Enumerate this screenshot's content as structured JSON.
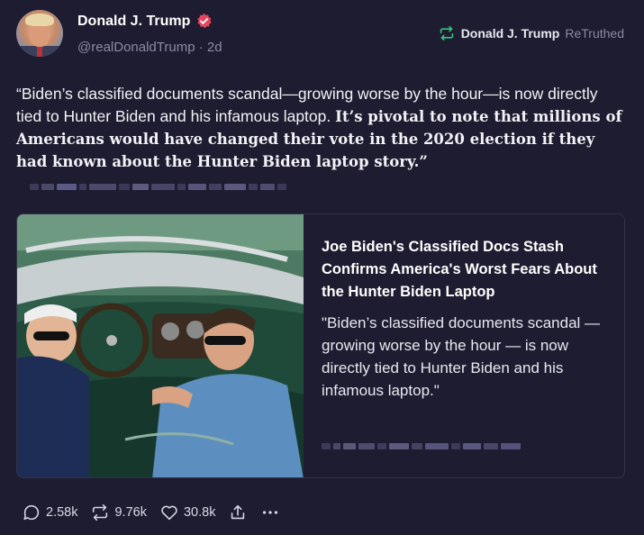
{
  "author": {
    "name": "Donald J. Trump",
    "handle": "@realDonaldTrump",
    "separator": "·",
    "age": "2d"
  },
  "retruth": {
    "name": "Donald J. Trump",
    "label": "ReTruthed"
  },
  "post": {
    "text_plain": "“Biden’s classified documents scandal—growing worse by the hour—is now directly tied to Hunter Biden and his infamous laptop.",
    "text_bold": "It’s pivotal to note that millions of Americans would have changed their vote in the 2020 election if they had known about the Hunter Biden laptop story.”"
  },
  "card": {
    "title": "Joe Biden's Classified Docs Stash Confirms America's Worst Fears About the Hunter Biden Laptop",
    "description": "\"Biden’s classified documents scandal — growing worse by the hour — is now directly tied to Hunter Biden and his infamous laptop.\""
  },
  "actions": {
    "replies": "2.58k",
    "retruths": "9.76k",
    "likes": "30.8k"
  },
  "colors": {
    "background": "#1e1c30",
    "verified": "#e3465d",
    "retruth_green": "#38c27d",
    "muted": "#8b89a6"
  },
  "icons": [
    "verified-badge-icon",
    "retruth-icon",
    "reply-icon",
    "like-icon",
    "share-icon",
    "more-icon"
  ]
}
